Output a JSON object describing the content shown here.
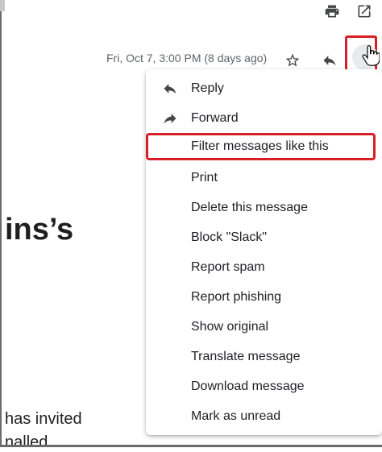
{
  "toolbar": {
    "print_icon": "print-icon",
    "open_new_window_icon": "open-in-new-window-icon"
  },
  "message_header": {
    "date": "Fri, Oct 7, 3:00 PM (8 days ago)",
    "star_icon": "star-icon",
    "reply_icon": "reply-icon",
    "more_icon": "more-options-icon"
  },
  "email": {
    "heading_fragment": "ins’s",
    "body_line_1": "has invited",
    "body_line_2": "nalled"
  },
  "menu": {
    "items": [
      {
        "label": "Reply",
        "icon": "reply-icon"
      },
      {
        "label": "Forward",
        "icon": "forward-icon"
      },
      {
        "label": "Filter messages like this",
        "highlighted": true
      },
      {
        "label": "Print"
      },
      {
        "label": "Delete this message"
      },
      {
        "label": "Block \"Slack\""
      },
      {
        "label": "Report spam"
      },
      {
        "label": "Report phishing"
      },
      {
        "label": "Show original"
      },
      {
        "label": "Translate message"
      },
      {
        "label": "Download message"
      },
      {
        "label": "Mark as unread"
      }
    ]
  },
  "colors": {
    "highlight_border": "#d91f26",
    "text": "#202124",
    "secondary_text": "#5f6368"
  }
}
